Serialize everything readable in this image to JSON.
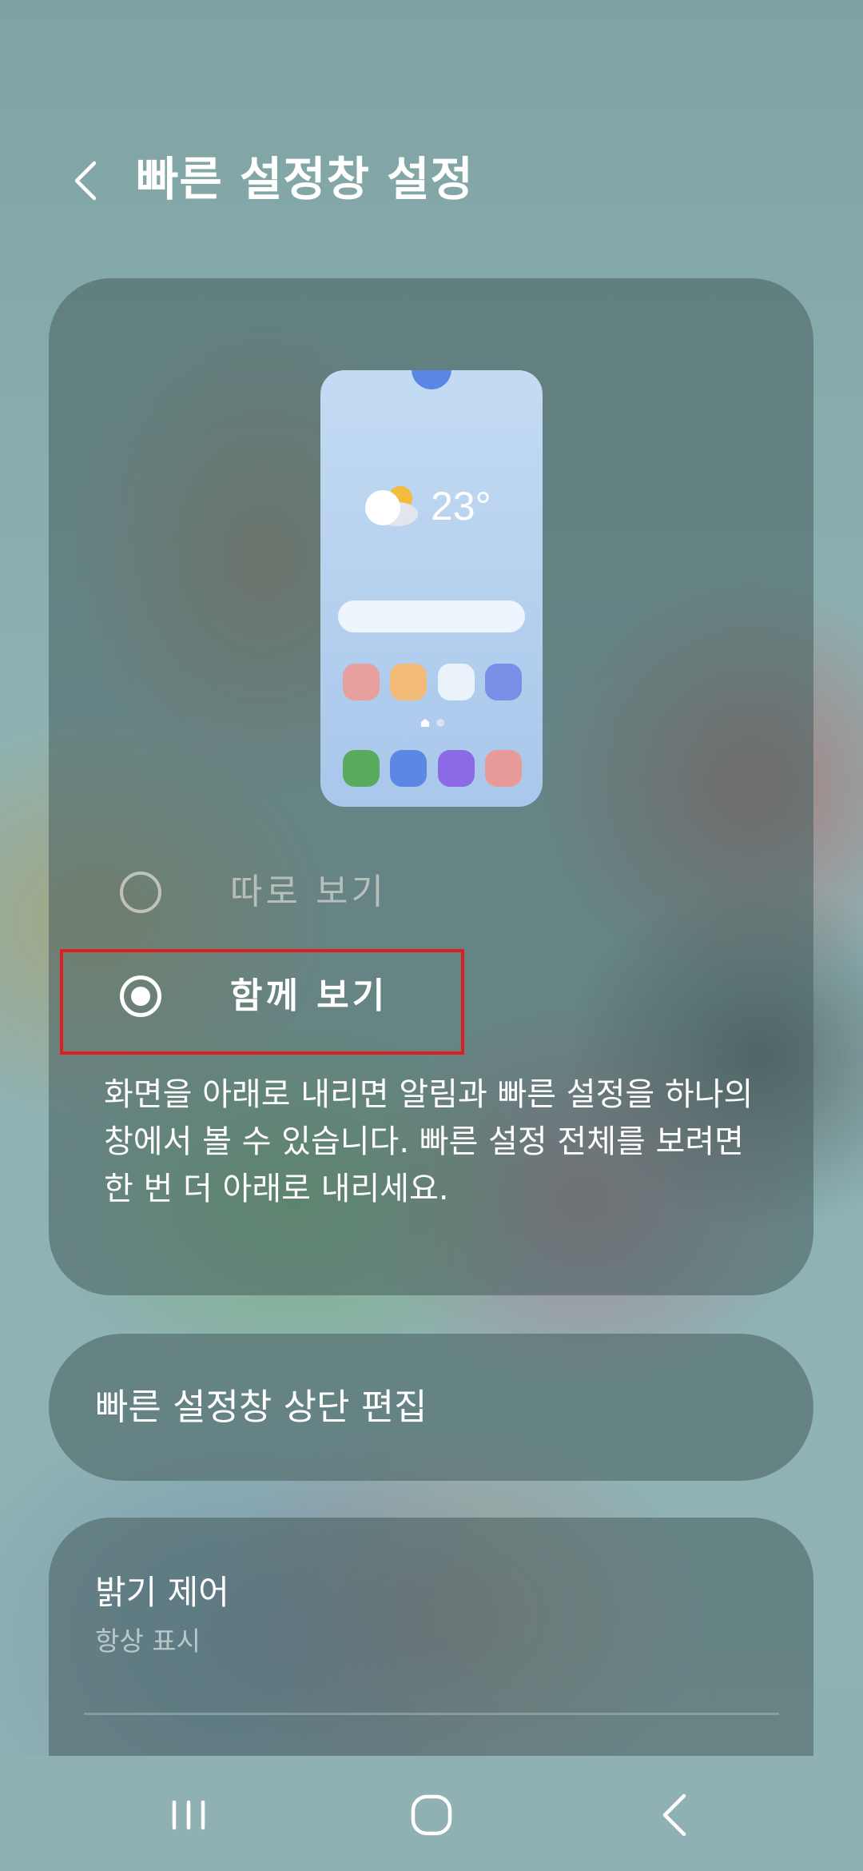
{
  "header": {
    "title": "빠른 설정창 설정",
    "back_icon": "chevron-left-icon"
  },
  "preview": {
    "weather_icon": "partly-cloudy-icon",
    "temperature": "23°",
    "app_colors_row1": [
      "#e8a09e",
      "#f2bb78",
      "#eaf2fa",
      "#7b8fe8"
    ],
    "app_colors_row2": [
      "#5aaa5e",
      "#5b88e2",
      "#8c6ae6",
      "#e89a98"
    ]
  },
  "options": {
    "separate_label": "따로 보기",
    "together_label": "함께 보기",
    "selected": "together"
  },
  "description": "화면을 아래로 내리면 알림과 빠른 설정을 하나의 창에서 볼 수 있습니다. 빠른 설정 전체를 보려면 한 번 더 아래로 내리세요.",
  "edit_item": {
    "label": "빠른 설정창 상단 편집"
  },
  "brightness_item": {
    "title": "밝기 제어",
    "subtitle": "항상 표시"
  },
  "navigation": {
    "recents_icon": "recents-icon",
    "home_icon": "home-icon",
    "back_icon": "back-icon"
  },
  "colors": {
    "highlight": "#dc2020",
    "phone_camera": "#5b86e4"
  }
}
